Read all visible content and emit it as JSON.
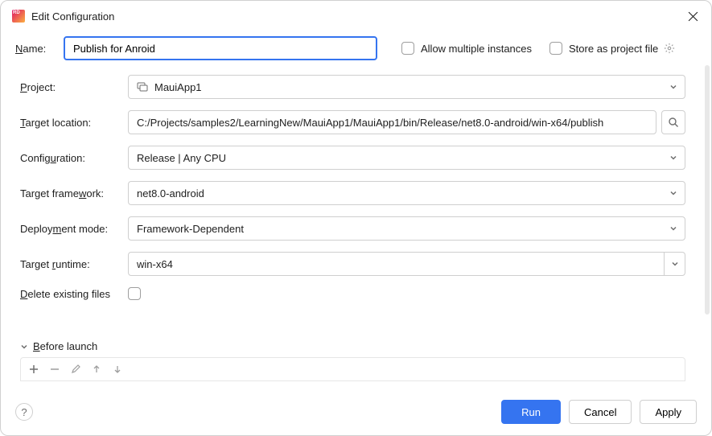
{
  "dialog": {
    "title": "Edit Configuration"
  },
  "name": {
    "label_pre": "N",
    "label_post": "ame:",
    "value": "Publish for Anroid"
  },
  "options": {
    "allow_multiple": "Allow multiple instances",
    "store_as_project": "Store as project file"
  },
  "fields": {
    "project": {
      "label_pre": "P",
      "label_post": "roject:",
      "value": "MauiApp1"
    },
    "target_location": {
      "label_pre": "T",
      "label_post": "arget location:",
      "value": "C:/Projects/samples2/LearningNew/MauiApp1/MauiApp1/bin/Release/net8.0-android/win-x64/publish"
    },
    "configuration": {
      "label": "Config",
      "u": "u",
      "label2": "ration:",
      "value": "Release | Any CPU"
    },
    "target_framework": {
      "label": "Target frame",
      "u": "w",
      "label2": "ork:",
      "value": "net8.0-android"
    },
    "deployment_mode": {
      "label": "Deploy",
      "u": "m",
      "label2": "ent mode:",
      "value": "Framework-Dependent"
    },
    "target_runtime": {
      "label": "Target ",
      "u": "r",
      "label2": "untime:",
      "value": "win-x64"
    },
    "delete_existing": {
      "u": "D",
      "label": "elete existing files"
    }
  },
  "sections": {
    "before_launch": {
      "u": "B",
      "label": "efore launch"
    }
  },
  "buttons": {
    "run": "Run",
    "cancel": "Cancel",
    "apply": "Apply"
  }
}
